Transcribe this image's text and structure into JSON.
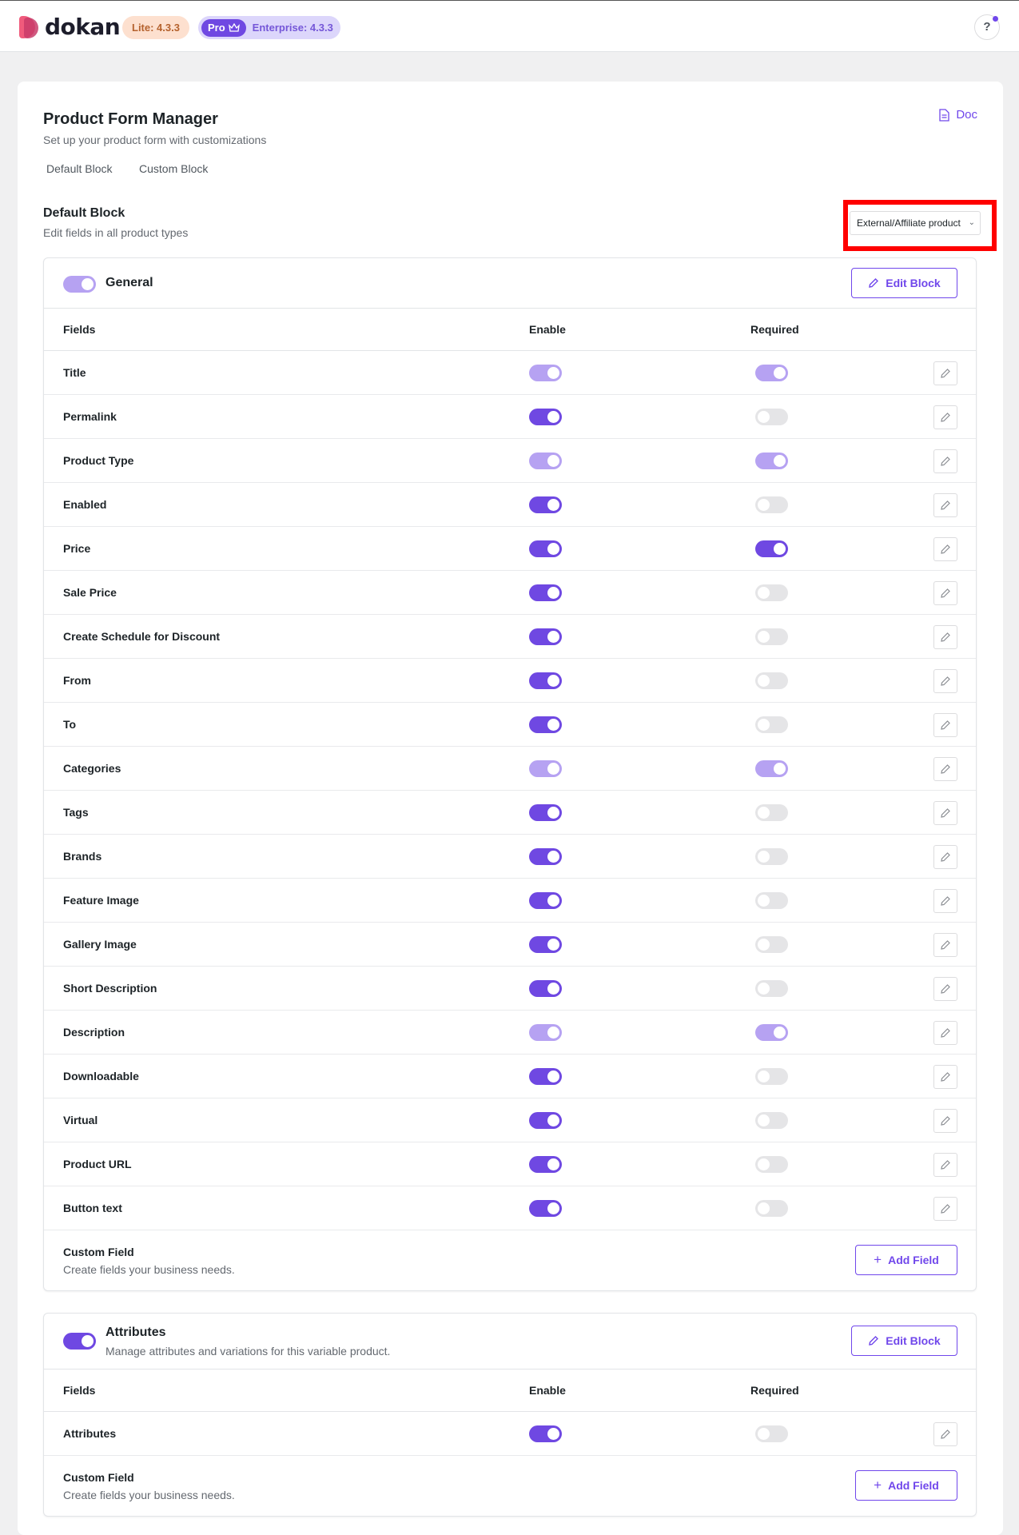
{
  "header": {
    "brand": "dokan",
    "lite_badge": "Lite: 4.3.3",
    "pro_badge": "Pro",
    "enterprise_badge": "Enterprise: 4.3.3",
    "help": "?"
  },
  "page": {
    "title": "Product Form Manager",
    "subtitle": "Set up your product form with customizations",
    "doc_link": "Doc",
    "tabs": [
      "Default Block",
      "Custom Block"
    ]
  },
  "default_block": {
    "title": "Default Block",
    "subtitle": "Edit fields in all product types",
    "product_type_select": "External/Affiliate product"
  },
  "general": {
    "name": "General",
    "toggle": "dim",
    "edit_label": "Edit Block",
    "columns": [
      "Fields",
      "Enable",
      "Required"
    ],
    "rows": [
      {
        "label": "Title",
        "enable": "dim",
        "required": "dim"
      },
      {
        "label": "Permalink",
        "enable": "on",
        "required": "off"
      },
      {
        "label": "Product Type",
        "enable": "dim",
        "required": "dim"
      },
      {
        "label": "Enabled",
        "enable": "on",
        "required": "off"
      },
      {
        "label": "Price",
        "enable": "on",
        "required": "on"
      },
      {
        "label": "Sale Price",
        "enable": "on",
        "required": "off"
      },
      {
        "label": "Create Schedule for Discount",
        "enable": "on",
        "required": "off"
      },
      {
        "label": "From",
        "enable": "on",
        "required": "off"
      },
      {
        "label": "To",
        "enable": "on",
        "required": "off"
      },
      {
        "label": "Categories",
        "enable": "dim",
        "required": "dim"
      },
      {
        "label": "Tags",
        "enable": "on",
        "required": "off"
      },
      {
        "label": "Brands",
        "enable": "on",
        "required": "off"
      },
      {
        "label": "Feature Image",
        "enable": "on",
        "required": "off"
      },
      {
        "label": "Gallery Image",
        "enable": "on",
        "required": "off"
      },
      {
        "label": "Short Description",
        "enable": "on",
        "required": "off"
      },
      {
        "label": "Description",
        "enable": "dim",
        "required": "dim"
      },
      {
        "label": "Downloadable",
        "enable": "on",
        "required": "off"
      },
      {
        "label": "Virtual",
        "enable": "on",
        "required": "off"
      },
      {
        "label": "Product URL",
        "enable": "on",
        "required": "off"
      },
      {
        "label": "Button text",
        "enable": "on",
        "required": "off"
      }
    ],
    "custom_field_title": "Custom Field",
    "custom_field_sub": "Create fields your business needs.",
    "add_label": "Add Field"
  },
  "attributes": {
    "name": "Attributes",
    "description": "Manage attributes and variations for this variable product.",
    "toggle": "on",
    "edit_label": "Edit Block",
    "columns": [
      "Fields",
      "Enable",
      "Required"
    ],
    "rows": [
      {
        "label": "Attributes",
        "enable": "on",
        "required": "off"
      }
    ],
    "custom_field_title": "Custom Field",
    "custom_field_sub": "Create fields your business needs.",
    "add_label": "Add Field"
  },
  "colors": {
    "accent": "#7047eb",
    "highlight": "#ff0000"
  }
}
